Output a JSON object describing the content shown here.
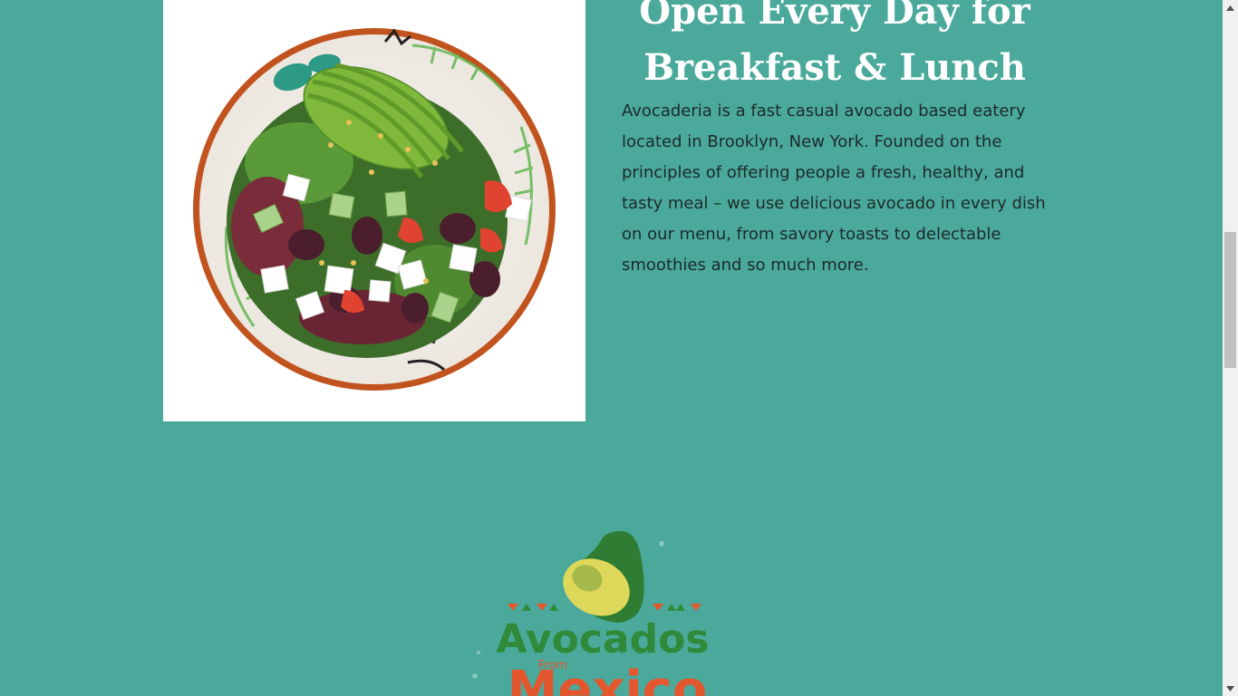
{
  "about": {
    "headline_line1": "Open Every Day for",
    "headline_line2": "Breakfast & Lunch",
    "description": "Avocaderia is a fast casual avocado based eatery located in Brooklyn, New York. Founded on the principles of offering people a fresh, healthy, and tasty meal – we use delicious avocado in every dish on our menu, from savory toasts to delectable smoothies and so much more.",
    "photo": "avocado-salad-plate"
  },
  "sponsor": {
    "logo_line1": "Avocados",
    "logo_line2": "From",
    "logo_line3": "Mexico"
  },
  "colors": {
    "background": "#4aa99b",
    "headline": "#ffffff",
    "body_text": "#1d2a2a",
    "logo_green": "#2f8a3a",
    "logo_orange": "#e4572e"
  }
}
